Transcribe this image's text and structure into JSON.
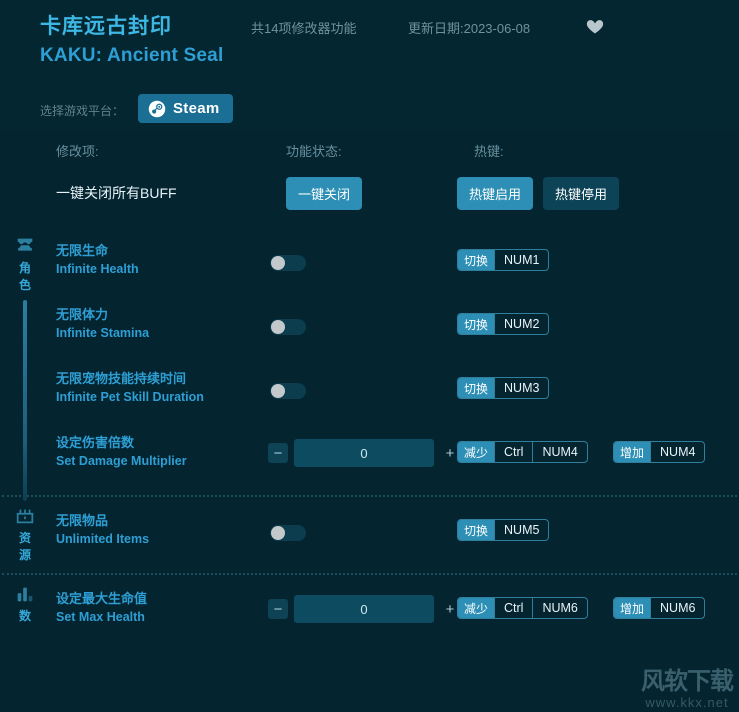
{
  "header": {
    "title_cn": "卡库远古封印",
    "title_en": "KAKU: Ancient Seal",
    "feature_count_text": "共14项修改器功能",
    "update_date_text": "更新日期:2023-06-08",
    "favorite_icon": "heart-icon",
    "platform_label": "选择游戏平台：",
    "platform_button": {
      "label": "Steam",
      "icon": "steam-icon"
    },
    "accent_color": "#2d8fb5",
    "title_color": "#3db7e4",
    "background_color": "#042630"
  },
  "columns": {
    "item": "修改项:",
    "status": "功能状态:",
    "hotkey": "热键:"
  },
  "master_row": {
    "label": "一键关闭所有BUFF",
    "action_button": "一键关闭",
    "hotkey_enable": "热键启用",
    "hotkey_disable": "热键停用"
  },
  "sections": [
    {
      "id": "character",
      "icon": "helmet-icon",
      "name": "角色",
      "rows": [
        {
          "cn": "无限生命",
          "en": "Infinite Health",
          "control": "toggle",
          "toggle_on": false,
          "hotkeys": [
            {
              "action": "切换",
              "keys": [
                "NUM1"
              ]
            }
          ]
        },
        {
          "cn": "无限体力",
          "en": "Infinite Stamina",
          "control": "toggle",
          "toggle_on": false,
          "hotkeys": [
            {
              "action": "切换",
              "keys": [
                "NUM2"
              ]
            }
          ]
        },
        {
          "cn": "无限宠物技能持续时间",
          "en": "Infinite Pet Skill Duration",
          "control": "toggle",
          "toggle_on": false,
          "hotkeys": [
            {
              "action": "切换",
              "keys": [
                "NUM3"
              ]
            }
          ]
        },
        {
          "cn": "设定伤害倍数",
          "en": "Set Damage Multiplier",
          "control": "stepper",
          "value": "0",
          "minus_label": "−",
          "plus_label": "+",
          "hotkeys": [
            {
              "action": "减少",
              "keys": [
                "Ctrl",
                "NUM4"
              ]
            },
            {
              "action": "增加",
              "keys": [
                "NUM4"
              ]
            }
          ]
        }
      ]
    },
    {
      "id": "resources",
      "icon": "chest-icon",
      "name": "资源",
      "rows": [
        {
          "cn": "无限物品",
          "en": "Unlimited Items",
          "control": "toggle",
          "toggle_on": false,
          "hotkeys": [
            {
              "action": "切换",
              "keys": [
                "NUM5"
              ]
            }
          ]
        }
      ]
    },
    {
      "id": "stats",
      "icon": "bar-chart-icon",
      "name": "数",
      "rows": [
        {
          "cn": "设定最大生命值",
          "en": "Set Max Health",
          "control": "stepper",
          "value": "0",
          "minus_label": "−",
          "plus_label": "+",
          "hotkeys": [
            {
              "action": "减少",
              "keys": [
                "Ctrl",
                "NUM6"
              ]
            },
            {
              "action": "增加",
              "keys": [
                "NUM6"
              ]
            }
          ]
        }
      ]
    }
  ],
  "watermark": {
    "cn": "风软下载",
    "url": "www.kkx.net"
  }
}
